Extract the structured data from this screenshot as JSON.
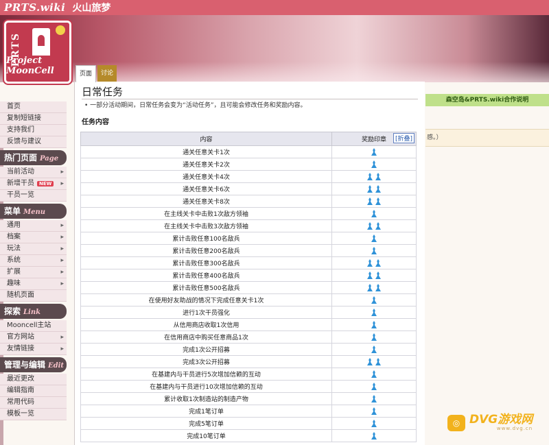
{
  "header": {
    "site_name": "PRTS.wiki",
    "page_name": "火山旅梦"
  },
  "logo": {
    "mark": "PRTS",
    "subtitle": "Project MoonCell"
  },
  "tabs": {
    "page": "页面",
    "talk": "讨论"
  },
  "sidebar": {
    "top_items": [
      {
        "label": "首页",
        "arrow": false
      },
      {
        "label": "复制短链接",
        "arrow": false
      },
      {
        "label": "支持我们",
        "arrow": false
      },
      {
        "label": "反馈与建议",
        "arrow": false
      }
    ],
    "sections": [
      {
        "title": "热门页面",
        "script": "Page",
        "items": [
          {
            "label": "当前活动",
            "arrow": true
          },
          {
            "label": "新增干员",
            "arrow": true,
            "badge": "NEW"
          },
          {
            "label": "干员一览",
            "arrow": false
          }
        ]
      },
      {
        "title": "菜单",
        "script": "Menu",
        "items": [
          {
            "label": "通用",
            "arrow": true
          },
          {
            "label": "档案",
            "arrow": true
          },
          {
            "label": "玩法",
            "arrow": true
          },
          {
            "label": "系统",
            "arrow": true
          },
          {
            "label": "扩展",
            "arrow": true
          },
          {
            "label": "趣味",
            "arrow": true
          },
          {
            "label": "随机页面",
            "arrow": false
          }
        ]
      },
      {
        "title": "探索",
        "script": "Link",
        "items": [
          {
            "label": "Mooncell主站",
            "arrow": false
          },
          {
            "label": "官方网站",
            "arrow": true
          },
          {
            "label": "友情链接",
            "arrow": true
          }
        ]
      },
      {
        "title": "管理与编辑",
        "script": "Edit",
        "items": [
          {
            "label": "最近更改",
            "arrow": false
          },
          {
            "label": "编辑指南",
            "arrow": false
          },
          {
            "label": "常用代码",
            "arrow": false
          },
          {
            "label": "模板一览",
            "arrow": false
          }
        ]
      }
    ]
  },
  "main": {
    "title": "日常任务",
    "note": "一部分活动期间，日常任务会变为“活动任务”，且可能会修改任务和奖励内容。",
    "section": "任务内容",
    "table": {
      "headers": [
        "内容",
        "奖励印章"
      ],
      "collapse_label": "[折叠]",
      "rows": [
        {
          "content": "通关任意关卡1次",
          "stamps": 1
        },
        {
          "content": "通关任意关卡2次",
          "stamps": 1
        },
        {
          "content": "通关任意关卡4次",
          "stamps": 2
        },
        {
          "content": "通关任意关卡6次",
          "stamps": 2
        },
        {
          "content": "通关任意关卡8次",
          "stamps": 2
        },
        {
          "content": "在主线关卡中击败1次敌方领袖",
          "stamps": 1
        },
        {
          "content": "在主线关卡中击败3次敌方领袖",
          "stamps": 2
        },
        {
          "content": "累计击败任意100名敌兵",
          "stamps": 1
        },
        {
          "content": "累计击败任意200名敌兵",
          "stamps": 1
        },
        {
          "content": "累计击败任意300名敌兵",
          "stamps": 2
        },
        {
          "content": "累计击败任意400名敌兵",
          "stamps": 2
        },
        {
          "content": "累计击败任意500名敌兵",
          "stamps": 2
        },
        {
          "content": "在使用好友助战的情况下完成任意关卡1次",
          "stamps": 1
        },
        {
          "content": "进行1次干员强化",
          "stamps": 1
        },
        {
          "content": "从信用商店收取1次信用",
          "stamps": 1
        },
        {
          "content": "在信用商店中购买任意商品1次",
          "stamps": 1
        },
        {
          "content": "完成1次公开招募",
          "stamps": 1
        },
        {
          "content": "完成3次公开招募",
          "stamps": 2
        },
        {
          "content": "在基建内与干员进行5次增加信赖的互动",
          "stamps": 1
        },
        {
          "content": "在基建内与干员进行10次增加信赖的互动",
          "stamps": 1
        },
        {
          "content": "累计收取1次制造站的制造产物",
          "stamps": 1
        },
        {
          "content": "完成1笔订单",
          "stamps": 1
        },
        {
          "content": "完成5笔订单",
          "stamps": 1
        },
        {
          "content": "完成10笔订单",
          "stamps": 1
        }
      ]
    }
  },
  "right_panel": {
    "banner": "森空岛&PRTS.wiki合作说明",
    "note": "感。）"
  },
  "watermark": {
    "main": "DVG游戏网",
    "sub": "www.dvg.cn",
    "icon": "gamepad-icon"
  },
  "colors": {
    "brand": "#d9606f",
    "stamp": "#2f92d8",
    "sidebar_head": "#5b4a4e",
    "talk_tab": "#b58a2a",
    "right_banner": "#bfe08a"
  }
}
